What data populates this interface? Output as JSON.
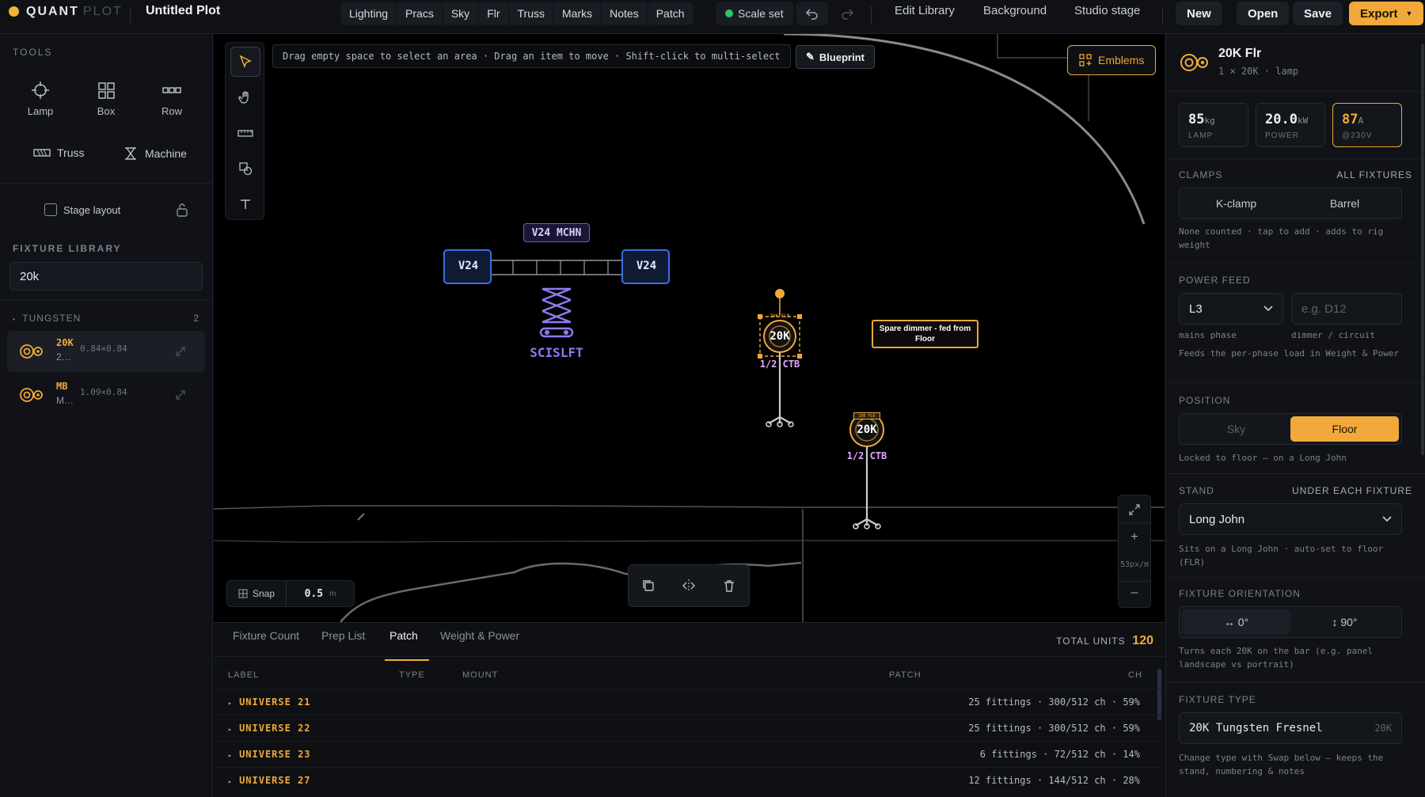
{
  "app": {
    "brand": "QUANT",
    "brand_suffix": "PLOT",
    "doc_title": "Untitled Plot"
  },
  "toolbar": {
    "groups": [
      "Lighting",
      "Pracs",
      "Sky",
      "Flr",
      "Truss",
      "Marks",
      "Notes",
      "Patch"
    ],
    "scale_label": "Scale set",
    "links": [
      "Edit Library",
      "Background",
      "Studio stage"
    ],
    "new_label": "New",
    "open_label": "Open",
    "save_label": "Save",
    "export_label": "Export"
  },
  "tools": {
    "section_label": "TOOLS",
    "lamp": "Lamp",
    "box": "Box",
    "row": "Row",
    "truss": "Truss",
    "machine": "Machine",
    "stage_layout": "Stage layout"
  },
  "library": {
    "section_label": "FIXTURE LIBRARY",
    "search_value": "20k",
    "group_label": "TUNGSTEN",
    "group_count": "2",
    "items": [
      {
        "name": "20K",
        "sub": "2…",
        "dim": "0.84×0.84"
      },
      {
        "name": "MB",
        "sub": "M…",
        "dim": "1.09×0.84"
      }
    ]
  },
  "canvas": {
    "hint": "Drag empty space to select an area · Drag an item to move · Shift-click to multi-select",
    "blueprint_label": "Blueprint",
    "emblems_label": "Emblems",
    "machine_label": "V24 MCHN",
    "v24_left": "V24",
    "v24_right": "V24",
    "scissor_label": "SCISLFT",
    "fixture1": {
      "label": "20K",
      "gel": "1/2 CTB",
      "tag": "20K FLR"
    },
    "fixture2": {
      "label": "20K",
      "gel": "1/2 CTB",
      "tag": "20K FLR"
    },
    "note": "Spare dimmer - fed from Floor",
    "snap_label": "Snap",
    "snap_value": "0.5",
    "snap_unit": "m",
    "zoom_readout": "53px/m"
  },
  "bottom": {
    "tabs": [
      "Fixture Count",
      "Prep List",
      "Patch",
      "Weight & Power"
    ],
    "active_tab": "Patch",
    "total_label": "TOTAL UNITS",
    "total_value": "120",
    "columns": [
      "LABEL",
      "TYPE",
      "MOUNT",
      "PATCH",
      "CH"
    ],
    "rows": [
      {
        "label": "UNIVERSE 21",
        "patch": "25 fittings · 300/512 ch · 59%"
      },
      {
        "label": "UNIVERSE 22",
        "patch": "25 fittings · 300/512 ch · 59%"
      },
      {
        "label": "UNIVERSE 23",
        "patch": "6 fittings · 72/512 ch · 14%"
      },
      {
        "label": "UNIVERSE 27",
        "patch": "12 fittings · 144/512 ch · 28%"
      }
    ]
  },
  "inspector": {
    "title": "20K Flr",
    "subtitle": "1 × 20K · lamp",
    "stats": [
      {
        "value": "85",
        "unit": "kg",
        "label": "LAMP"
      },
      {
        "value": "20.0",
        "unit": "kW",
        "label": "POWER"
      },
      {
        "value": "87",
        "unit": "A",
        "label": "@230V"
      }
    ],
    "clamps": {
      "label": "CLAMPS",
      "right": "ALL FIXTURES",
      "options": [
        "K-clamp",
        "Barrel"
      ],
      "note": "None counted · tap to add · adds to rig weight"
    },
    "power_feed": {
      "label": "POWER FEED",
      "phase": "L3",
      "circuit_placeholder": "e.g. D12",
      "phase_caption": "mains phase",
      "circuit_caption": "dimmer / circuit",
      "note": "Feeds the per-phase load in Weight & Power"
    },
    "position": {
      "label": "POSITION",
      "options": [
        "Sky",
        "Floor"
      ],
      "selected": "Floor",
      "note": "Locked to floor — on a Long John"
    },
    "stand": {
      "label": "STAND",
      "right": "UNDER EACH FIXTURE",
      "value": "Long John",
      "note": "Sits on a Long John · auto-set to floor (FLR)"
    },
    "orientation": {
      "label": "FIXTURE ORIENTATION",
      "options": [
        "↔ 0°",
        "↕ 90°"
      ],
      "note": "Turns each 20K on the bar (e.g. panel landscape vs portrait)"
    },
    "fixture_type": {
      "label": "FIXTURE TYPE",
      "value": "20K Tungsten Fresnel",
      "code": "20K",
      "note": "Change type with Swap below — keeps the stand, numbering & notes"
    }
  },
  "colors": {
    "accent": "#f0a93a",
    "selection": "#3c6ee0",
    "machine": "#8a7cf0",
    "gel": "#e0a8ff"
  }
}
